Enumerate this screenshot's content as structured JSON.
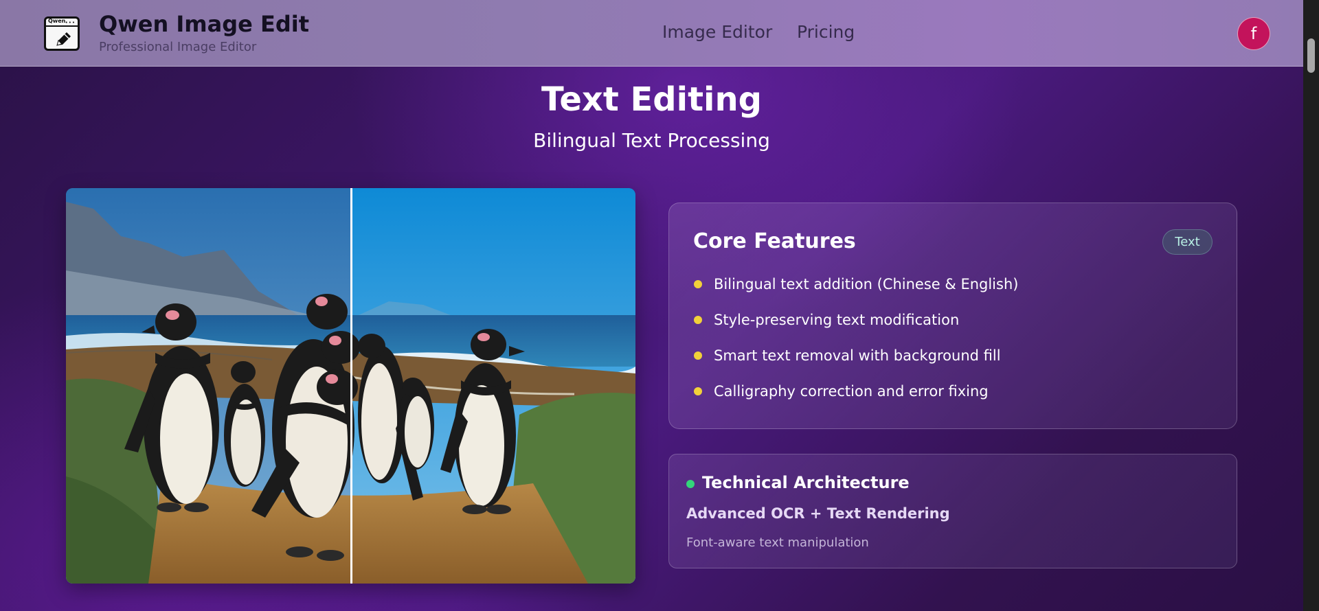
{
  "header": {
    "logo_label": "Qwen",
    "brand_title": "Qwen Image Edit",
    "brand_subtitle": "Professional Image Editor",
    "nav": [
      {
        "label": "Image Editor"
      },
      {
        "label": "Pricing"
      }
    ],
    "avatar_initial": "f"
  },
  "hero": {
    "title": "Text Editing",
    "subtitle": "Bilingual Text Processing"
  },
  "comparison": {
    "image_subject": "penguins-on-beach",
    "divider_position_fraction": 0.5
  },
  "core_features": {
    "title": "Core Features",
    "badge": "Text",
    "items": [
      "Bilingual text addition (Chinese & English)",
      "Style-preserving text modification",
      "Smart text removal with background fill",
      "Calligraphy correction and error fixing"
    ]
  },
  "technical": {
    "title": "Technical Architecture",
    "architecture": "Advanced OCR + Text Rendering",
    "description": "Font-aware text manipulation"
  },
  "colors": {
    "accent_yellow": "#f2d13a",
    "accent_green": "#33d67a",
    "avatar": "#c3135b",
    "badge_text": "#b8f0e4"
  }
}
